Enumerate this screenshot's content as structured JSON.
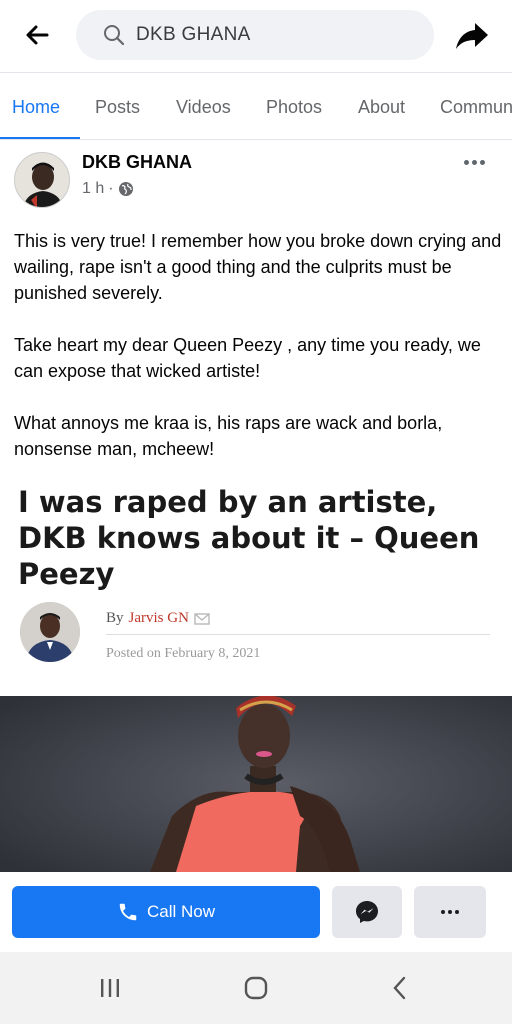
{
  "search": {
    "query": "DKB GHANA",
    "back_icon": "back-arrow-icon",
    "share_icon": "share-icon"
  },
  "tabs": [
    {
      "label": "Home",
      "active": true
    },
    {
      "label": "Posts",
      "active": false
    },
    {
      "label": "Videos",
      "active": false
    },
    {
      "label": "Photos",
      "active": false
    },
    {
      "label": "About",
      "active": false
    },
    {
      "label": "Commun",
      "active": false
    }
  ],
  "post": {
    "page_name": "DKB GHANA",
    "time": "1 h",
    "separator": "·",
    "privacy_icon": "globe-icon",
    "paragraphs": [
      "This is very true! I remember how you broke down crying and wailing, rape isn't a good thing and the culprits must be punished severely.",
      "Take heart my dear Queen Peezy , any time you ready, we can expose that wicked artiste!",
      "What annoys me kraa is, his raps are wack and borla, nonsense man, mcheew!"
    ]
  },
  "article": {
    "title": "I was raped by an artiste, DKB knows about it – Queen Peezy",
    "by_prefix": "By",
    "author": "Jarvis GN",
    "posted_on": "Posted on February 8, 2021"
  },
  "cta": {
    "call_label": "Call Now",
    "call_icon": "phone-icon",
    "messenger_icon": "messenger-icon",
    "more_icon": "more-icon"
  },
  "colors": {
    "accent": "#1877f2",
    "author_link": "#c0392b",
    "photo_bg": "#474a52",
    "dress": "#f06a5f"
  }
}
